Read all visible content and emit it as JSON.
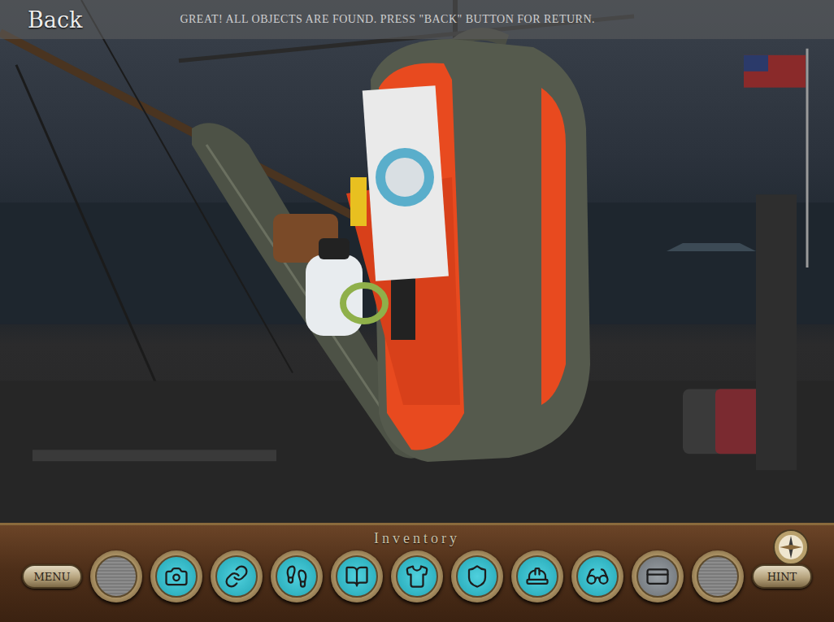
{
  "top_bar": {
    "back_button": "Back",
    "message": "GREAT! ALL OBJECTS ARE FOUND. PRESS \"BACK\" BUTTON FOR RETURN."
  },
  "inventory": {
    "title": "Inventory",
    "slots": [
      {
        "kind": "empty"
      },
      {
        "kind": "item"
      },
      {
        "kind": "item"
      },
      {
        "kind": "item"
      },
      {
        "kind": "item"
      },
      {
        "kind": "item"
      },
      {
        "kind": "item"
      },
      {
        "kind": "item"
      },
      {
        "kind": "item"
      },
      {
        "kind": "used"
      },
      {
        "kind": "empty"
      }
    ]
  },
  "buttons": {
    "menu": "MENU",
    "hint": "HINT"
  }
}
